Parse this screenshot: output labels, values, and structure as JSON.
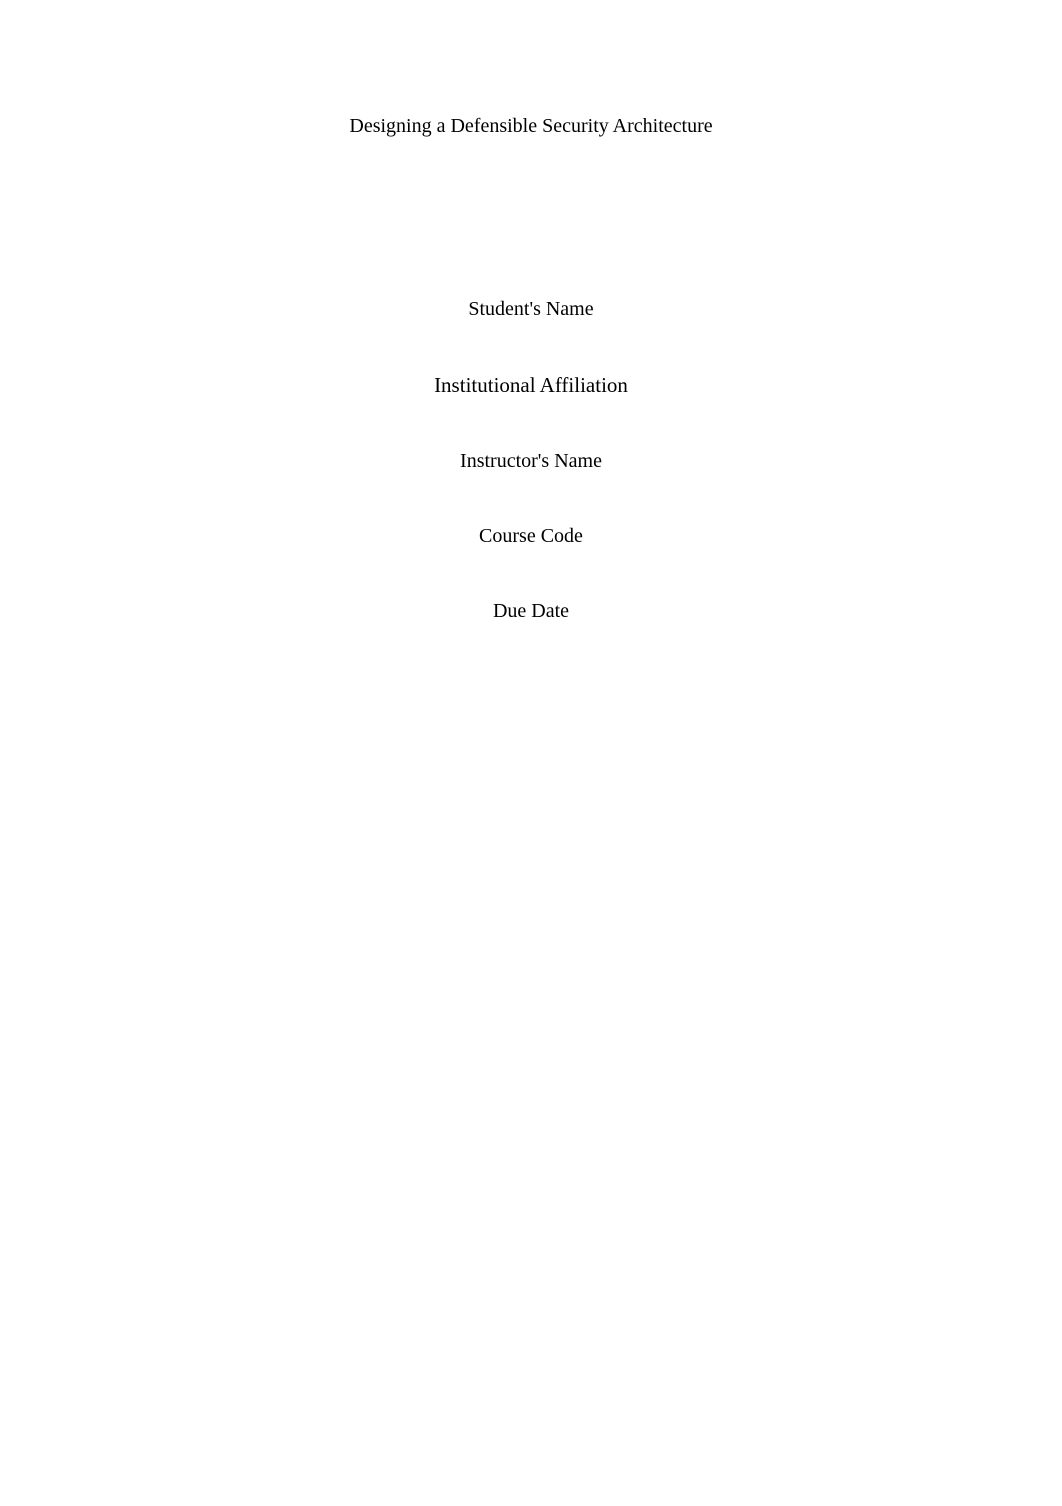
{
  "title": "Designing a Defensible Security Architecture",
  "fields": {
    "student_name": "Student's Name",
    "institution": "Institutional Affiliation",
    "instructor": "Instructor's Name",
    "course": "Course Code",
    "due_date": "Due Date"
  }
}
